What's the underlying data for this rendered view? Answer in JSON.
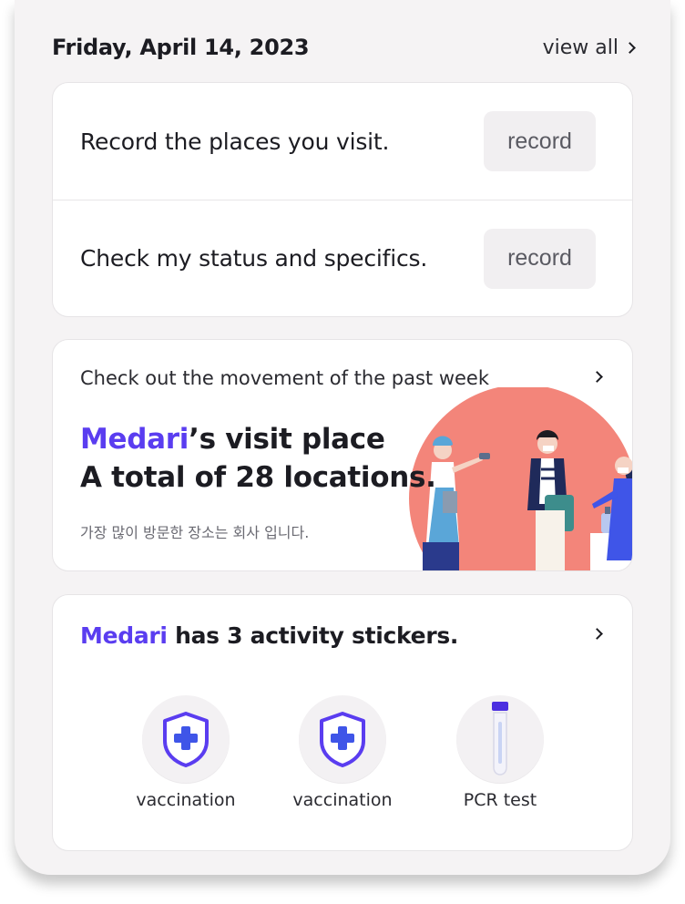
{
  "header": {
    "date": "Friday, April 14, 2023",
    "view_all": "view all"
  },
  "record_card": {
    "rows": [
      {
        "text": "Record the places you visit.",
        "button": "record"
      },
      {
        "text": "Check my status and specifics.",
        "button": "record"
      }
    ]
  },
  "movement_card": {
    "subtitle": "Check out the movement of the past week",
    "name": "Medari",
    "title_line1_rest": "’s visit place",
    "title_line2": "A total of 28 locations.",
    "note": "가장 많이 방문한 장소는 회사 입니다."
  },
  "sticker_card": {
    "name": "Medari",
    "title_rest": " has 3 activity stickers.",
    "items": [
      {
        "label": "vaccination",
        "icon": "shield-plus-icon"
      },
      {
        "label": "vaccination",
        "icon": "shield-plus-icon"
      },
      {
        "label": "PCR test",
        "icon": "test-tube-icon"
      }
    ]
  },
  "colors": {
    "accent": "#5a3df0",
    "panel_bg": "#f5f3f4",
    "illustration_circle": "#f3857a"
  }
}
